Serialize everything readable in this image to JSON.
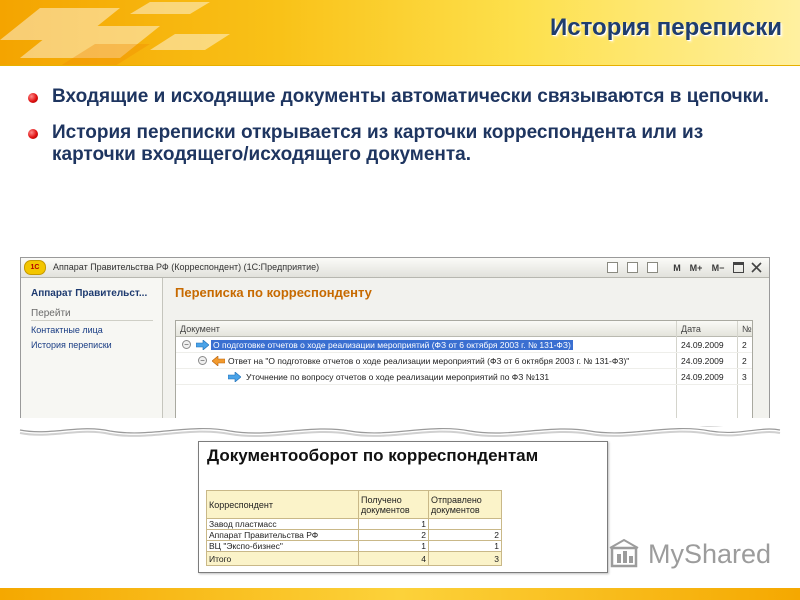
{
  "slide": {
    "title": "История переписки",
    "bullets": [
      "Входящие и исходящие документы автоматически связываются в цепочки.",
      "История переписки открывается из карточки корреспондента или из карточки входящего/исходящего документа."
    ]
  },
  "window": {
    "logo": "1С",
    "title": "Аппарат Правительства РФ (Корреспондент) (1С:Предприятие)",
    "toolbar": [
      "M",
      "M+",
      "M−"
    ]
  },
  "sidebar": {
    "title": "Аппарат Правительст...",
    "section": "Перейти",
    "links": [
      "Контактные лица",
      "История переписки"
    ]
  },
  "form": {
    "title": "Переписка по корреспонденту",
    "columns": {
      "document": "Документ",
      "date": "Дата",
      "number": "№"
    },
    "rows": [
      {
        "doc": "О подготовке отчетов о ходе реализации мероприятий (ФЗ от 6 октября 2003 г. № 131-ФЗ)",
        "date": "24.09.2009",
        "num": "2",
        "level": 0,
        "selected": true
      },
      {
        "doc": "Ответ на \"О подготовке отчетов о ходе реализации мероприятий (ФЗ от 6 октября 2003 г. № 131-ФЗ)\"",
        "date": "24.09.2009",
        "num": "2",
        "level": 1,
        "selected": false
      },
      {
        "doc": "Уточнение по вопросу отчетов о ходе реализации мероприятий по ФЗ №131",
        "date": "24.09.2009",
        "num": "3",
        "level": 2,
        "selected": false
      }
    ]
  },
  "report": {
    "title": "Документооборот по корреспондентам",
    "headers": [
      "Корреспондент",
      "Получено документов",
      "Отправлено документов"
    ],
    "rows": [
      {
        "name": "Завод пластмасс",
        "received": "1",
        "sent": ""
      },
      {
        "name": "Аппарат Правительства РФ",
        "received": "2",
        "sent": "2"
      },
      {
        "name": "ВЦ \"Экспо-бизнес\"",
        "received": "1",
        "sent": "1"
      }
    ],
    "total": {
      "label": "Итого",
      "received": "4",
      "sent": "3"
    }
  },
  "watermark": {
    "text": "MyShared"
  },
  "colors": {
    "accent": "#f9c218",
    "title": "#1f3d6e",
    "selection": "#3a6fd1",
    "form_title": "#c76a00"
  }
}
